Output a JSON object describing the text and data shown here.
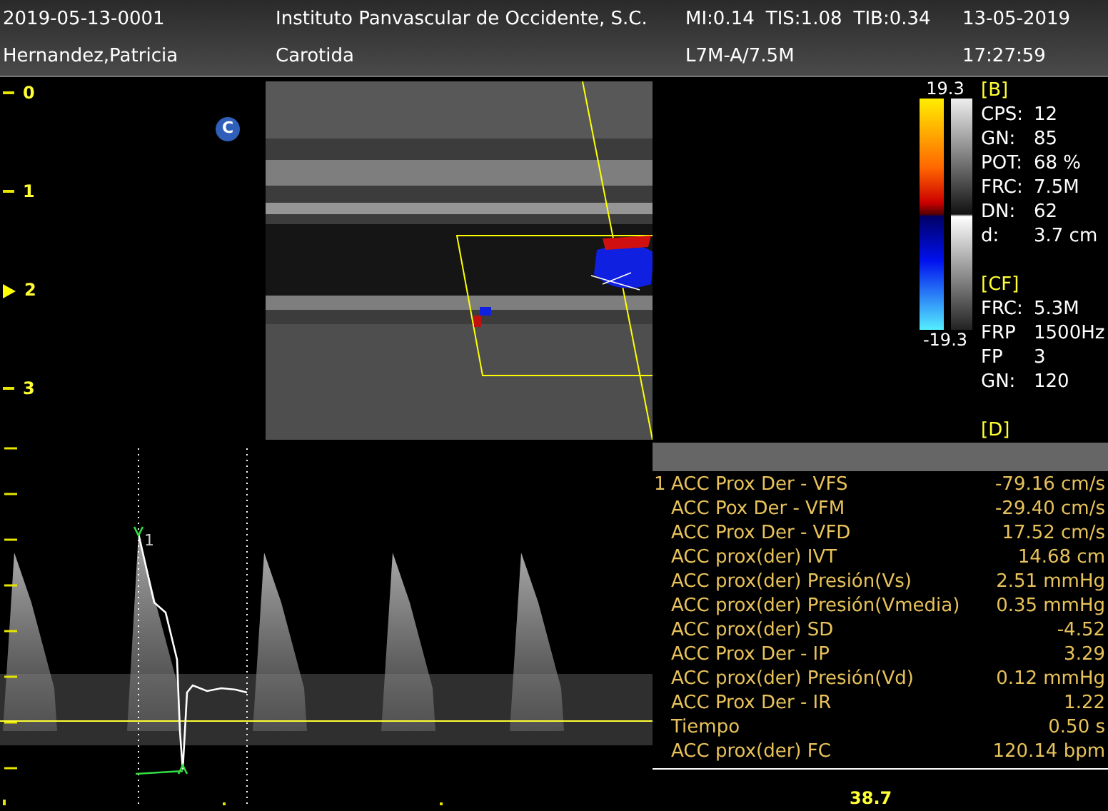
{
  "header": {
    "patient_id": "2019-05-13-0001",
    "patient_name": "Hernandez,Patricia",
    "institution": "Instituto Panvascular de Occidente, S.C.",
    "exam": "Carotida",
    "mi": "MI:0.14",
    "tis": "TIS:1.08",
    "tib": "TIB:0.34",
    "probe": "L7M-A/7.5M",
    "date": "13-05-2019",
    "time": "17:27:59"
  },
  "depth_scale": [
    {
      "label": "0",
      "selected": false
    },
    {
      "label": "1",
      "selected": false
    },
    {
      "label": "2",
      "selected": true
    },
    {
      "label": "3",
      "selected": false
    }
  ],
  "mode_badge": "C",
  "color_scale": {
    "max": "19.3",
    "min": "-19.3"
  },
  "params": [
    {
      "title": "[B]",
      "rows": [
        {
          "label": "CPS:",
          "value": "12"
        },
        {
          "label": "GN:",
          "value": "85"
        },
        {
          "label": "POT:",
          "value": "68 %"
        },
        {
          "label": "FRC:",
          "value": "7.5M"
        },
        {
          "label": "DN:",
          "value": "62"
        },
        {
          "label": "d:",
          "value": "3.7 cm"
        }
      ]
    },
    {
      "title": "[CF]",
      "rows": [
        {
          "label": "FRC:",
          "value": "5.3M"
        },
        {
          "label": "FRP",
          "value": "1500Hz"
        },
        {
          "label": "FP",
          "value": "3"
        },
        {
          "label": "GN:",
          "value": "120"
        }
      ]
    },
    {
      "title": "[D]"
    }
  ],
  "spectral": {
    "trace_marker": "1"
  },
  "measurements": {
    "marker": "1",
    "rows": [
      {
        "label": "ACC Prox Der - VFS",
        "value": "-79.16 cm/s"
      },
      {
        "label": "ACC Pox Der - VFM",
        "value": "-29.40 cm/s"
      },
      {
        "label": "ACC Prox Der - VFD",
        "value": "17.52 cm/s"
      },
      {
        "label": "ACC prox(der) IVT",
        "value": "14.68 cm"
      },
      {
        "label": "ACC prox(der) Presión(Vs)",
        "value": "2.51 mmHg"
      },
      {
        "label": "ACC prox(der) Presión(Vmedia)",
        "value": "0.35 mmHg"
      },
      {
        "label": "ACC prox(der) SD",
        "value": "-4.52"
      },
      {
        "label": "ACC Prox Der - IP",
        "value": "3.29"
      },
      {
        "label": "ACC prox(der) Presión(Vd)",
        "value": "0.12 mmHg"
      },
      {
        "label": "ACC Prox Der - IR",
        "value": "1.22"
      },
      {
        "label": "Tiempo",
        "value": "0.50 s"
      },
      {
        "label": "ACC prox(der) FC",
        "value": "120.14 bpm"
      }
    ]
  },
  "readout": "38.7"
}
